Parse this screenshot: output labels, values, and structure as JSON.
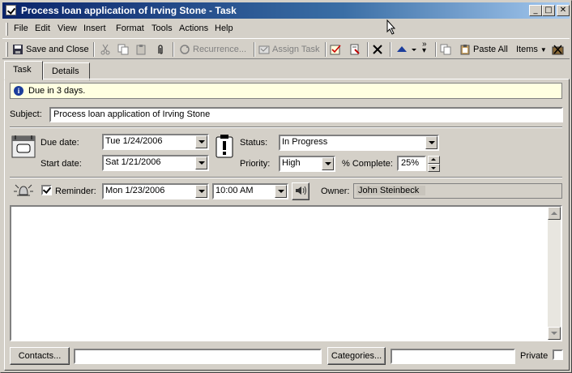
{
  "window": {
    "title": "Process loan application of Irving Stone - Task"
  },
  "menu": [
    "File",
    "Edit",
    "View",
    "Insert",
    "Format",
    "Tools",
    "Actions",
    "Help"
  ],
  "toolbar": {
    "save_close": "Save and Close",
    "recurrence": "Recurrence...",
    "assign_task": "Assign Task",
    "paste_all": "Paste All",
    "items": "Items"
  },
  "tabs": [
    "Task",
    "Details"
  ],
  "info": "Due in 3 days.",
  "form": {
    "subject_label": "Subject:",
    "subject": "Process loan application of Irving Stone",
    "due_label": "Due date:",
    "due": "Tue 1/24/2006",
    "start_label": "Start date:",
    "start": "Sat 1/21/2006",
    "status_label": "Status:",
    "status": "In Progress",
    "priority_label": "Priority:",
    "priority": "High",
    "complete_label": "% Complete:",
    "complete": "25%",
    "reminder_label": "Reminder:",
    "reminder_checked": true,
    "reminder_date": "Mon 1/23/2006",
    "reminder_time": "10:00 AM",
    "owner_label": "Owner:",
    "owner": "John Steinbeck"
  },
  "footer": {
    "contacts": "Contacts...",
    "contacts_value": "",
    "categories": "Categories...",
    "categories_value": "",
    "private_label": "Private",
    "private_checked": false
  }
}
